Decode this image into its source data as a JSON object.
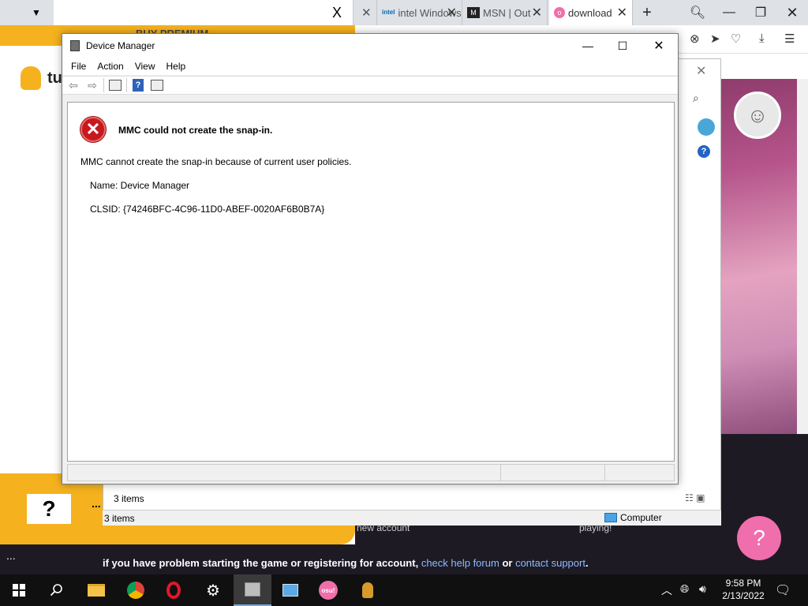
{
  "browser": {
    "tabs": [
      {
        "label": "intel Windows"
      },
      {
        "label": "MSN | Out"
      },
      {
        "label": "download"
      }
    ],
    "close_glyph": "X",
    "new_tab_glyph": "+"
  },
  "site": {
    "premium_label": "BUY PREMIUM",
    "logo_text": "tu",
    "help_box": "?",
    "dots": "...",
    "new_account": "new account",
    "playing": "playing!",
    "help_text": "if you have problem starting the game or registering for account,",
    "help_link1": "check help forum",
    "help_or": "or",
    "help_link2": "contact support",
    "help_end": ".",
    "pink_help": "?",
    "left_dots": "..."
  },
  "explorer": {
    "items_count_top": "3 items",
    "items_count_status": "3 items",
    "location": "Computer"
  },
  "device_manager": {
    "title": "Device Manager",
    "menu": [
      "File",
      "Action",
      "View",
      "Help"
    ],
    "error": {
      "title": "MMC could not create the snap-in.",
      "message": "MMC cannot create the snap-in because of current user policies.",
      "name_line": "Name: Device Manager",
      "clsid_line": "CLSID: {74246BFC-4C96-11D0-ABEF-0020AF6B0B7A}"
    }
  },
  "taskbar": {
    "time": "9:58 PM",
    "date": "2/13/2022",
    "osu_label": "osu!"
  },
  "icons": {
    "tab_menu": "chevron-down-icon",
    "error": "error-x-icon",
    "start": "windows-logo-icon",
    "search": "search-icon"
  },
  "colors": {
    "accent_yellow": "#f5b21e",
    "error_red": "#c9181d",
    "pink": "#f06eac",
    "link_blue": "#8fb9ff"
  }
}
